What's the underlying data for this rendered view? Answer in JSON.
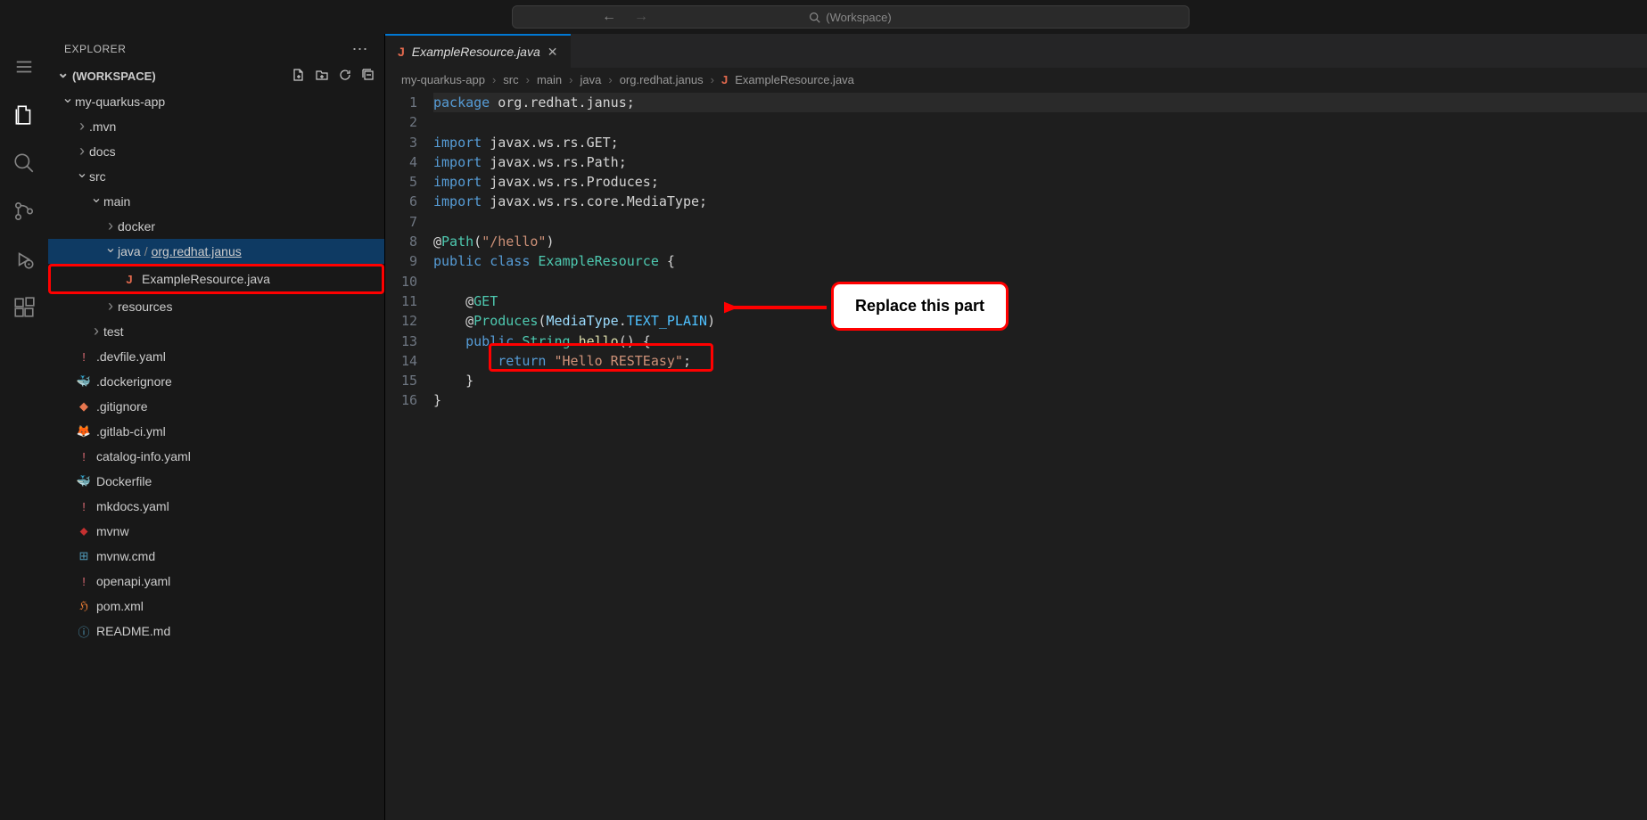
{
  "titlebar": {
    "search_placeholder": "(Workspace)"
  },
  "sidebar": {
    "title": "EXPLORER",
    "workspace_label": "(WORKSPACE)"
  },
  "tree": {
    "project": "my-quarkus-app",
    "mvn": ".mvn",
    "docs": "docs",
    "src": "src",
    "main": "main",
    "docker": "docker",
    "java_path": "java",
    "java_pkg": "org.redhat.janus",
    "example_resource": "ExampleResource.java",
    "resources": "resources",
    "test": "test",
    "devfile": ".devfile.yaml",
    "dockerignore": ".dockerignore",
    "gitignore": ".gitignore",
    "gitlabci": ".gitlab-ci.yml",
    "cataloginfo": "catalog-info.yaml",
    "dockerfile": "Dockerfile",
    "mkdocs": "mkdocs.yaml",
    "mvnw": "mvnw",
    "mvnwcmd": "mvnw.cmd",
    "openapi": "openapi.yaml",
    "pom": "pom.xml",
    "readme": "README.md"
  },
  "tab": {
    "filename": "ExampleResource.java"
  },
  "breadcrumbs": {
    "p0": "my-quarkus-app",
    "p1": "src",
    "p2": "main",
    "p3": "java",
    "p4": "org.redhat.janus",
    "p5": "ExampleResource.java"
  },
  "code": {
    "lines": [
      "1",
      "2",
      "3",
      "4",
      "5",
      "6",
      "7",
      "8",
      "9",
      "10",
      "11",
      "12",
      "13",
      "14",
      "15",
      "16"
    ],
    "l1_kw": "package",
    "l1_rest": " org.redhat.janus;",
    "l3_kw": "import",
    "l3_rest": " javax.ws.rs.GET;",
    "l4_kw": "import",
    "l4_rest": " javax.ws.rs.Path;",
    "l5_kw": "import",
    "l5_rest": " javax.ws.rs.Produces;",
    "l6_kw": "import",
    "l6_rest": " javax.ws.rs.core.MediaType;",
    "l8_at": "@",
    "l8_anno": "Path",
    "l8_p1": "(",
    "l8_str": "\"/hello\"",
    "l8_p2": ")",
    "l9_kw1": "public",
    "l9_kw2": "class",
    "l9_type": "ExampleResource",
    "l9_brace": " {",
    "l11_at": "@",
    "l11_anno": "GET",
    "l12_at": "@",
    "l12_anno": "Produces",
    "l12_p1": "(",
    "l12_prop": "MediaType",
    "l12_dot": ".",
    "l12_const": "TEXT_PLAIN",
    "l12_p2": ")",
    "l13_kw1": "public",
    "l13_type": "String",
    "l13_func": "hello",
    "l13_rest": "() {",
    "l14_kw": "return",
    "l14_str": "\"Hello RESTEasy\"",
    "l14_semi": ";",
    "l15": "}",
    "l16": "}"
  },
  "callout": {
    "text": "Replace this part"
  }
}
